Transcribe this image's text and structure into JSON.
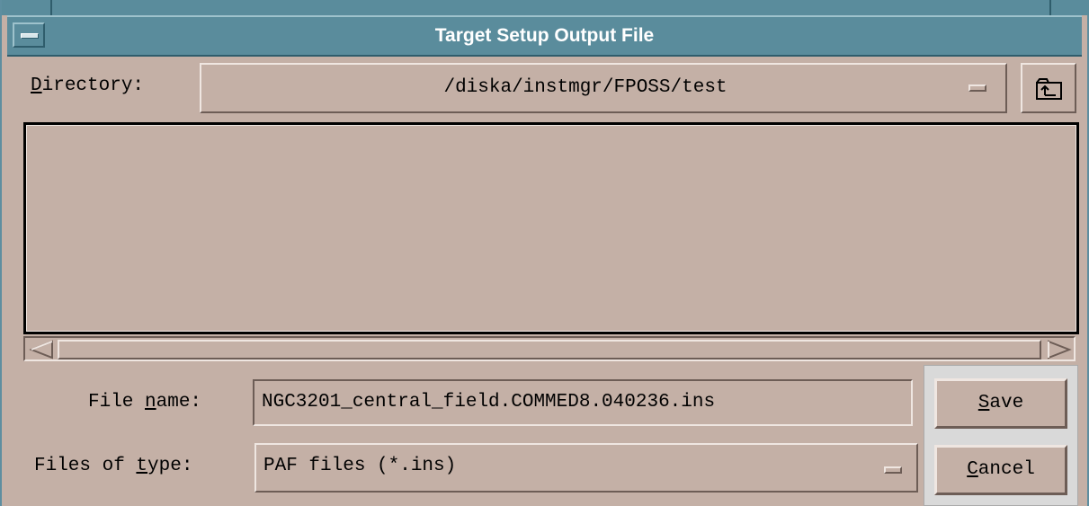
{
  "window": {
    "title": "Target Setup Output File",
    "menu_icon": "window-menu-icon"
  },
  "directory": {
    "label_underline": "D",
    "label_rest": "irectory:",
    "value": "/diska/instmgr/FPOSS/test",
    "up_icon": "parent-folder-icon"
  },
  "file_list": {
    "items": []
  },
  "filename": {
    "label_pre": "File ",
    "label_underline": "n",
    "label_post": "ame:",
    "value": "NGC3201_central_field.COMMED8.040236.ins"
  },
  "filetype": {
    "label_pre": "Files of ",
    "label_underline": "t",
    "label_post": "ype:",
    "selected": "PAF files (*.ins)"
  },
  "buttons": {
    "save_underline": "S",
    "save_rest": "ave",
    "cancel_underline": "C",
    "cancel_rest": "ancel"
  },
  "colors": {
    "background": "#c4b0a6",
    "titlebar": "#5a8c9c",
    "title_text": "#ffffff"
  }
}
